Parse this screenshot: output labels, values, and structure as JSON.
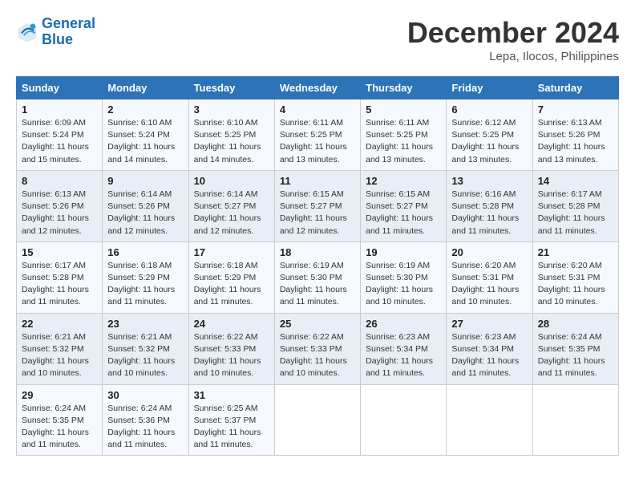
{
  "logo": {
    "line1": "General",
    "line2": "Blue"
  },
  "title": "December 2024",
  "subtitle": "Lepa, Ilocos, Philippines",
  "days_header": [
    "Sunday",
    "Monday",
    "Tuesday",
    "Wednesday",
    "Thursday",
    "Friday",
    "Saturday"
  ],
  "weeks": [
    [
      {
        "day": "1",
        "sunrise": "6:09 AM",
        "sunset": "5:24 PM",
        "daylight": "11 hours and 15 minutes."
      },
      {
        "day": "2",
        "sunrise": "6:10 AM",
        "sunset": "5:24 PM",
        "daylight": "11 hours and 14 minutes."
      },
      {
        "day": "3",
        "sunrise": "6:10 AM",
        "sunset": "5:25 PM",
        "daylight": "11 hours and 14 minutes."
      },
      {
        "day": "4",
        "sunrise": "6:11 AM",
        "sunset": "5:25 PM",
        "daylight": "11 hours and 13 minutes."
      },
      {
        "day": "5",
        "sunrise": "6:11 AM",
        "sunset": "5:25 PM",
        "daylight": "11 hours and 13 minutes."
      },
      {
        "day": "6",
        "sunrise": "6:12 AM",
        "sunset": "5:25 PM",
        "daylight": "11 hours and 13 minutes."
      },
      {
        "day": "7",
        "sunrise": "6:13 AM",
        "sunset": "5:26 PM",
        "daylight": "11 hours and 13 minutes."
      }
    ],
    [
      {
        "day": "8",
        "sunrise": "6:13 AM",
        "sunset": "5:26 PM",
        "daylight": "11 hours and 12 minutes."
      },
      {
        "day": "9",
        "sunrise": "6:14 AM",
        "sunset": "5:26 PM",
        "daylight": "11 hours and 12 minutes."
      },
      {
        "day": "10",
        "sunrise": "6:14 AM",
        "sunset": "5:27 PM",
        "daylight": "11 hours and 12 minutes."
      },
      {
        "day": "11",
        "sunrise": "6:15 AM",
        "sunset": "5:27 PM",
        "daylight": "11 hours and 12 minutes."
      },
      {
        "day": "12",
        "sunrise": "6:15 AM",
        "sunset": "5:27 PM",
        "daylight": "11 hours and 11 minutes."
      },
      {
        "day": "13",
        "sunrise": "6:16 AM",
        "sunset": "5:28 PM",
        "daylight": "11 hours and 11 minutes."
      },
      {
        "day": "14",
        "sunrise": "6:17 AM",
        "sunset": "5:28 PM",
        "daylight": "11 hours and 11 minutes."
      }
    ],
    [
      {
        "day": "15",
        "sunrise": "6:17 AM",
        "sunset": "5:28 PM",
        "daylight": "11 hours and 11 minutes."
      },
      {
        "day": "16",
        "sunrise": "6:18 AM",
        "sunset": "5:29 PM",
        "daylight": "11 hours and 11 minutes."
      },
      {
        "day": "17",
        "sunrise": "6:18 AM",
        "sunset": "5:29 PM",
        "daylight": "11 hours and 11 minutes."
      },
      {
        "day": "18",
        "sunrise": "6:19 AM",
        "sunset": "5:30 PM",
        "daylight": "11 hours and 11 minutes."
      },
      {
        "day": "19",
        "sunrise": "6:19 AM",
        "sunset": "5:30 PM",
        "daylight": "11 hours and 10 minutes."
      },
      {
        "day": "20",
        "sunrise": "6:20 AM",
        "sunset": "5:31 PM",
        "daylight": "11 hours and 10 minutes."
      },
      {
        "day": "21",
        "sunrise": "6:20 AM",
        "sunset": "5:31 PM",
        "daylight": "11 hours and 10 minutes."
      }
    ],
    [
      {
        "day": "22",
        "sunrise": "6:21 AM",
        "sunset": "5:32 PM",
        "daylight": "11 hours and 10 minutes."
      },
      {
        "day": "23",
        "sunrise": "6:21 AM",
        "sunset": "5:32 PM",
        "daylight": "11 hours and 10 minutes."
      },
      {
        "day": "24",
        "sunrise": "6:22 AM",
        "sunset": "5:33 PM",
        "daylight": "11 hours and 10 minutes."
      },
      {
        "day": "25",
        "sunrise": "6:22 AM",
        "sunset": "5:33 PM",
        "daylight": "11 hours and 10 minutes."
      },
      {
        "day": "26",
        "sunrise": "6:23 AM",
        "sunset": "5:34 PM",
        "daylight": "11 hours and 11 minutes."
      },
      {
        "day": "27",
        "sunrise": "6:23 AM",
        "sunset": "5:34 PM",
        "daylight": "11 hours and 11 minutes."
      },
      {
        "day": "28",
        "sunrise": "6:24 AM",
        "sunset": "5:35 PM",
        "daylight": "11 hours and 11 minutes."
      }
    ],
    [
      {
        "day": "29",
        "sunrise": "6:24 AM",
        "sunset": "5:35 PM",
        "daylight": "11 hours and 11 minutes."
      },
      {
        "day": "30",
        "sunrise": "6:24 AM",
        "sunset": "5:36 PM",
        "daylight": "11 hours and 11 minutes."
      },
      {
        "day": "31",
        "sunrise": "6:25 AM",
        "sunset": "5:37 PM",
        "daylight": "11 hours and 11 minutes."
      },
      null,
      null,
      null,
      null
    ]
  ]
}
